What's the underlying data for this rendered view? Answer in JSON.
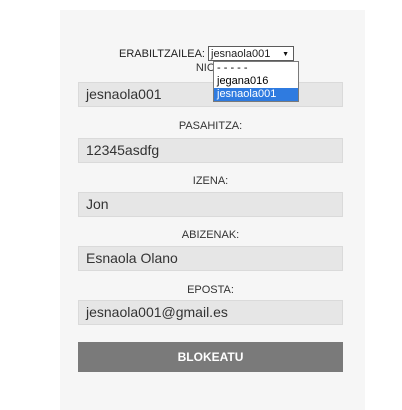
{
  "form": {
    "user_label": "ERABILTZAILEA:",
    "user_selected": "jesnaola001",
    "user_options": [
      "- - - - -",
      "jegana016",
      "jesnaola001"
    ],
    "nick_label": "NICK:",
    "nick_value": "jesnaola001",
    "password_label": "PASAHITZA:",
    "password_value": "12345asdfg",
    "name_label": "IZENA:",
    "name_value": "Jon",
    "surname_label": "ABIZENAK:",
    "surname_value": "Esnaola Olano",
    "email_label": "EPOSTA:",
    "email_value": "jesnaola001@gmail.es",
    "block_button": "BLOKEATU"
  }
}
